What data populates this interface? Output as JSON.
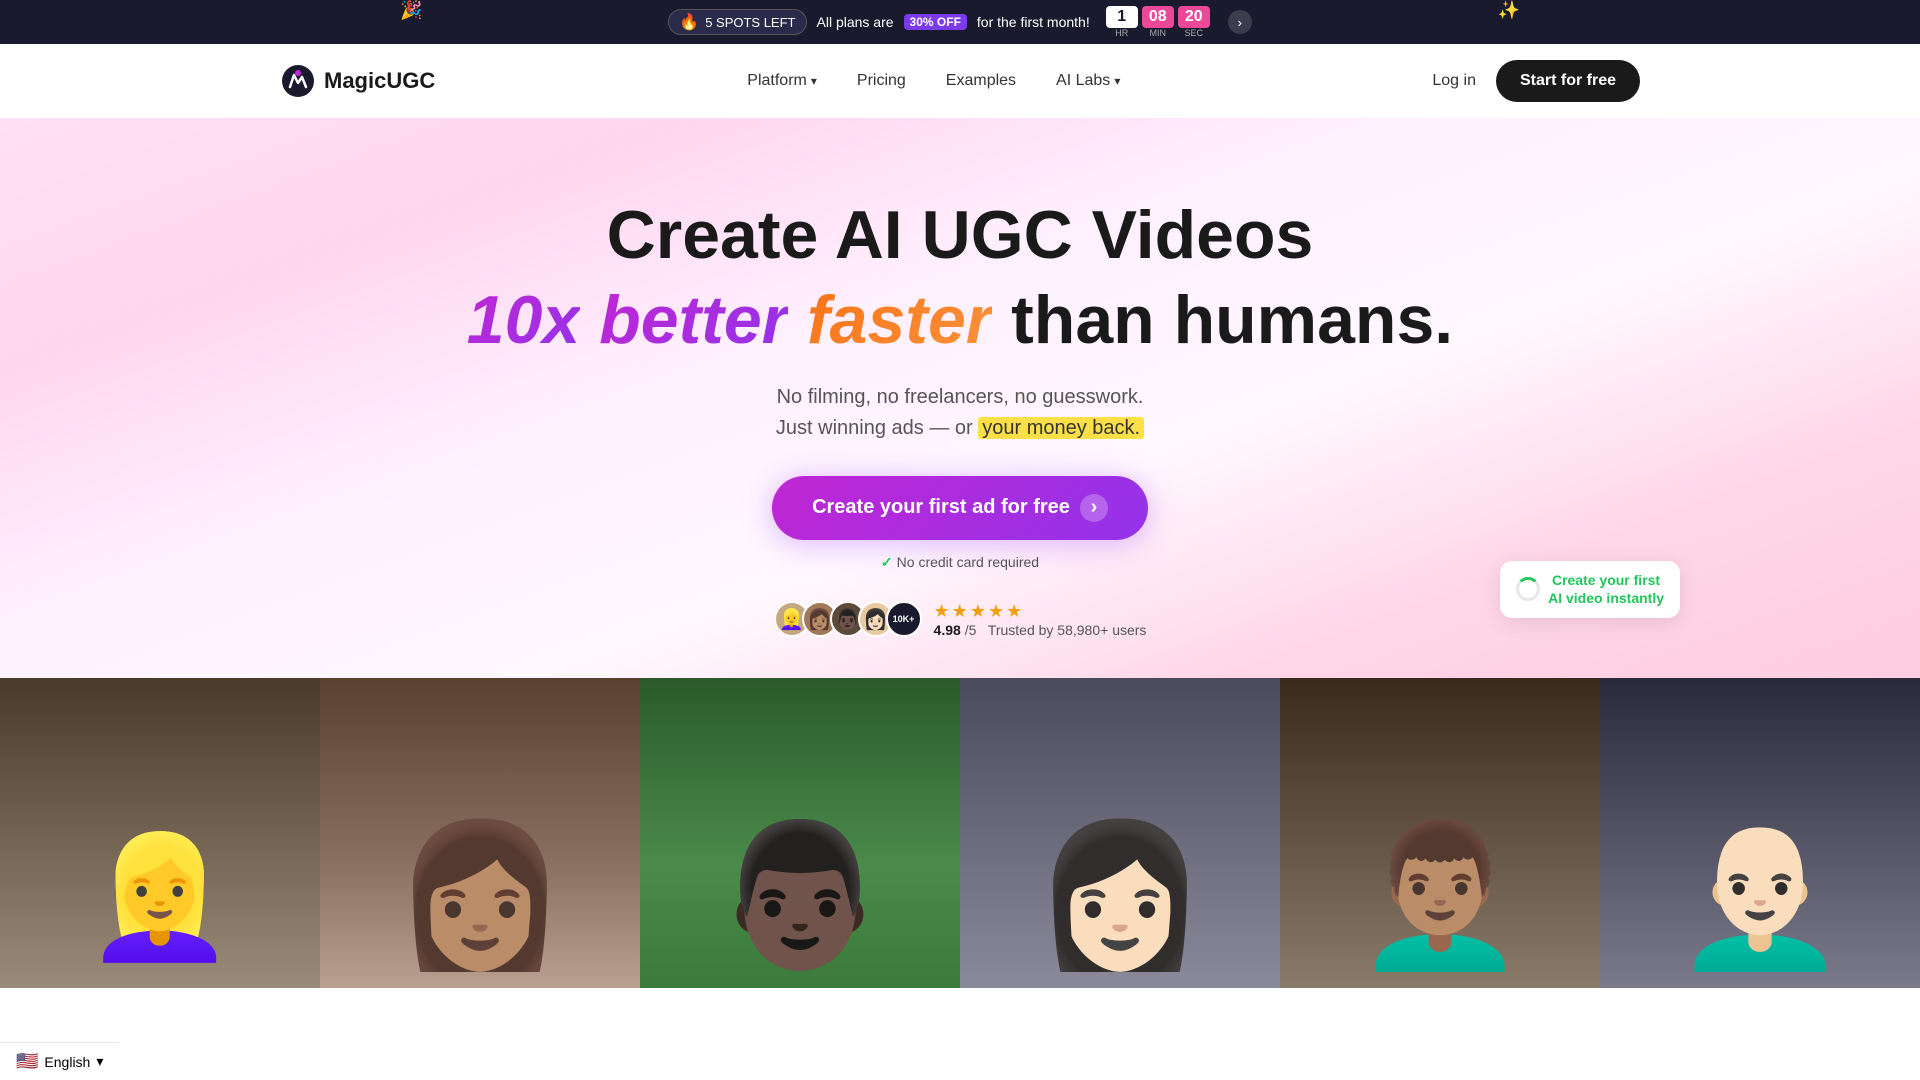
{
  "banner": {
    "spots_text": "5 SPOTS LEFT",
    "promo_text": "All plans are",
    "discount": "30% OFF",
    "promo_text2": "for the first month!",
    "timer": {
      "hours": "1",
      "hours_label": "HR",
      "minutes": "08",
      "minutes_label": "MIN",
      "seconds": "20",
      "seconds_label": "SEC"
    },
    "fire_emoji": "🔥"
  },
  "nav": {
    "logo_text": "MagicUGC",
    "platform_label": "Platform",
    "pricing_label": "Pricing",
    "examples_label": "Examples",
    "ai_labs_label": "AI Labs",
    "login_label": "Log in",
    "start_label": "Start for free"
  },
  "hero": {
    "title_line1": "Create AI UGC Videos",
    "title_line2_part1": "10x",
    "title_line2_part2": "better",
    "title_line2_part3": "&",
    "title_line2_part4": "faster",
    "title_line2_part5": "than humans.",
    "desc1": "No filming, no freelancers, no guesswork.",
    "desc2_prefix": "Just winning ads — or",
    "desc2_highlight": "your money back.",
    "cta_label": "Create your first ad for free",
    "no_cc": "No credit card required",
    "check_icon": "✓",
    "rating": "4.98",
    "rating_denom": "/5",
    "trusted_text": "Trusted by 58,980+ users",
    "avatars_badge": "10K+"
  },
  "floating_tooltip": {
    "text_line1": "Create your first",
    "text_line2": "AI video instantly"
  },
  "video_gallery": {
    "cards": [
      {
        "bg": "#5a4a3a",
        "emoji": "👱‍♀️"
      },
      {
        "bg": "#6a5a4a",
        "emoji": "👩🏽"
      },
      {
        "bg": "#3a6a3a",
        "emoji": "👨🏿"
      },
      {
        "bg": "#7a7a8a",
        "emoji": "👩🏻"
      },
      {
        "bg": "#5a4a3a",
        "emoji": "👨🏽‍🦱"
      },
      {
        "bg": "#4a4a5a",
        "emoji": "👨🏻‍🦲"
      }
    ]
  },
  "language_bar": {
    "flag": "🇺🇸",
    "language": "English",
    "chevron": "▾"
  }
}
